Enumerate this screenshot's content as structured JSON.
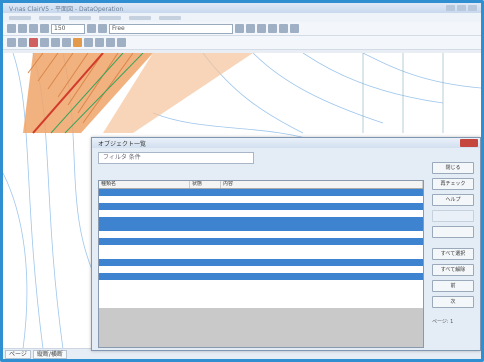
{
  "window": {
    "title": "V-nas ClairV5 - 平面図 - DataOperation"
  },
  "toolbar": {
    "scale_value": "150",
    "layer_combo": "Free"
  },
  "dialog": {
    "title": "オブジェクト一覧",
    "filter_text": "フィルタ 条件",
    "columns": [
      "種類名",
      "状態",
      "内容"
    ],
    "rows": [
      {
        "name": "",
        "state": "",
        "desc": "",
        "selected": true
      },
      {
        "name": "",
        "state": "",
        "desc": "",
        "selected": false
      },
      {
        "name": "",
        "state": "",
        "desc": "",
        "selected": true
      },
      {
        "name": "",
        "state": "",
        "desc": "",
        "selected": false
      },
      {
        "name": "",
        "state": "",
        "desc": "",
        "selected": true
      },
      {
        "name": "",
        "state": "",
        "desc": "",
        "selected": true
      },
      {
        "name": "",
        "state": "",
        "desc": "",
        "selected": false
      },
      {
        "name": "",
        "state": "",
        "desc": "",
        "selected": true
      },
      {
        "name": "",
        "state": "",
        "desc": "",
        "selected": false
      },
      {
        "name": "",
        "state": "",
        "desc": "",
        "selected": false
      },
      {
        "name": "",
        "state": "",
        "desc": "",
        "selected": true
      },
      {
        "name": "",
        "state": "",
        "desc": "",
        "selected": false
      },
      {
        "name": "",
        "state": "",
        "desc": "",
        "selected": true
      },
      {
        "name": "",
        "state": "",
        "desc": "",
        "selected": false
      },
      {
        "name": "",
        "state": "",
        "desc": "",
        "selected": false
      },
      {
        "name": "",
        "state": "",
        "desc": "",
        "selected": false
      },
      {
        "name": "",
        "state": "",
        "desc": "",
        "selected": false
      }
    ],
    "buttons": [
      "閉じる",
      "再チェック",
      "ヘルプ",
      "",
      "",
      "すべて選択",
      "すべて解除",
      "前",
      "次"
    ],
    "page_label": "ページ: 1"
  },
  "statusbar": {
    "tabs": [
      "ページ",
      "縦断/横断"
    ]
  },
  "colors": {
    "frame": "#2f8fd0",
    "selection": "#3d83cf",
    "contour": "#9ec6ec",
    "road_fill": "#f0a56a",
    "road_red": "#d23a2a",
    "road_green": "#35a35a"
  }
}
